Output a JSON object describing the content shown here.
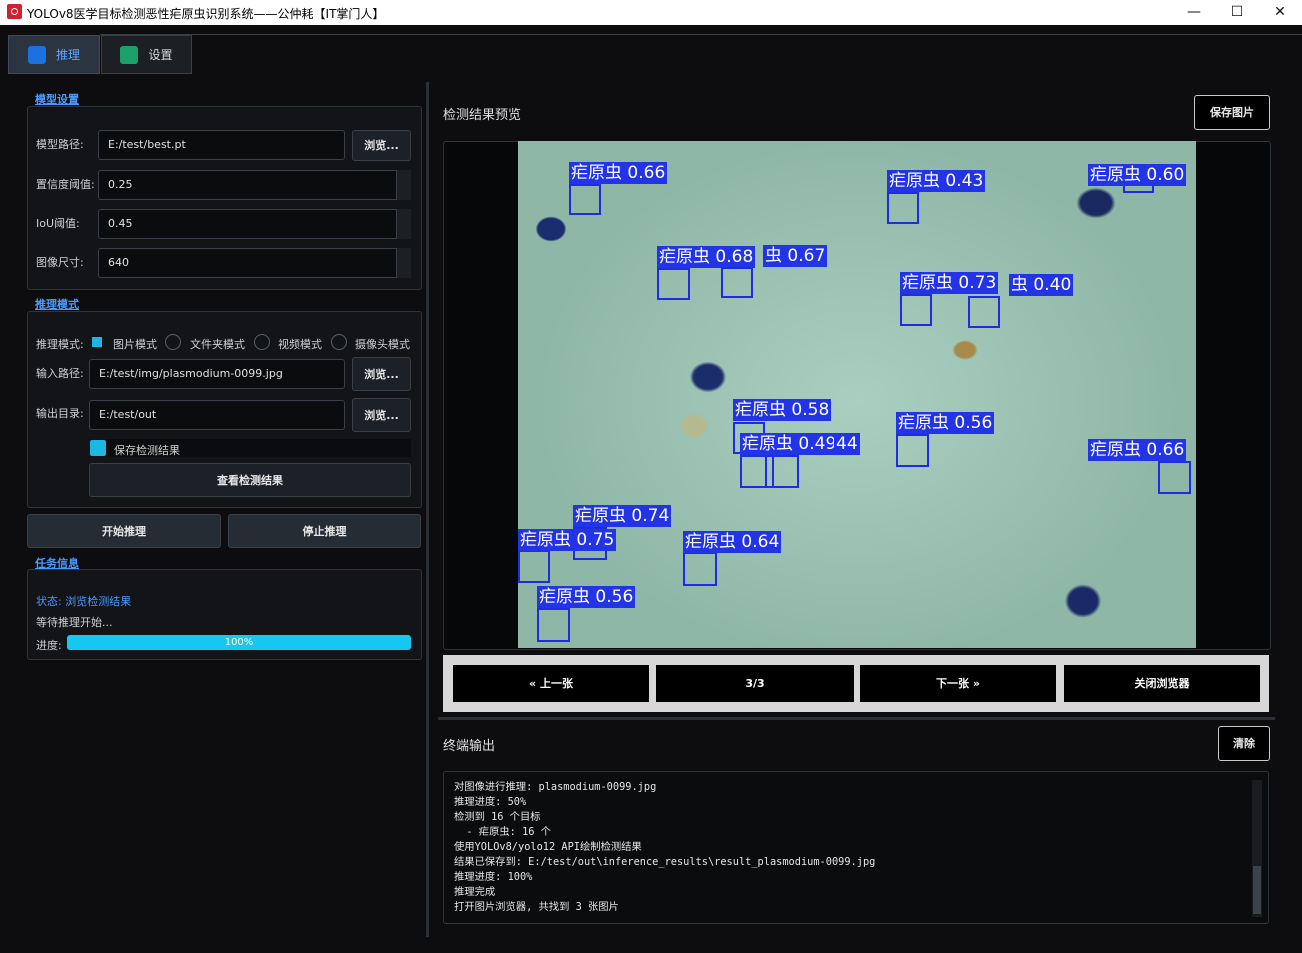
{
  "window": {
    "title": "YOLOv8医学目标检测恶性疟原虫识别系统——公仲耗【IT掌门人】",
    "minimize": "—",
    "maximize": "☐",
    "close": "✕"
  },
  "tabs": [
    {
      "label": "推理",
      "icon": "chart-icon",
      "active": true
    },
    {
      "label": "设置",
      "icon": "check-icon",
      "active": false
    }
  ],
  "model_settings": {
    "section": "模型设置",
    "model_path_label": "模型路径:",
    "model_path": "E:/test/best.pt",
    "browse": "浏览...",
    "conf_label": "置信度阈值:",
    "conf": "0.25",
    "iou_label": "IoU阈值:",
    "iou": "0.45",
    "imgsz_label": "图像尺寸:",
    "imgsz": "640"
  },
  "inference_mode": {
    "section": "推理模式",
    "mode_label": "推理模式:",
    "modes": [
      "图片模式",
      "文件夹模式",
      "视频模式",
      "摄像头模式"
    ],
    "selected_mode": "图片模式",
    "input_label": "输入路径:",
    "input": "E:/test/img/plasmodium-0099.jpg",
    "input_browse": "浏览...",
    "output_label": "输出目录:",
    "output": "E:/test/out",
    "output_browse": "浏览...",
    "save_label": "保存检测结果",
    "save_checked": true,
    "view_results": "查看检测结果"
  },
  "actions": {
    "start": "开始推理",
    "stop": "停止推理"
  },
  "task_info": {
    "section": "任务信息",
    "status": "状态: 浏览检测结果",
    "waiting": "等待推理开始...",
    "progress_label": "进度:",
    "progress_text": "100%",
    "progress_value": 1.0
  },
  "preview": {
    "title": "检测结果预览",
    "save_button": "保存图片",
    "detections": [
      {
        "label": "疟原虫 0.66"
      },
      {
        "label": "疟原虫 0.43"
      },
      {
        "label": "疟原虫 0.60"
      },
      {
        "label": "疟原虫 0.68"
      },
      {
        "label": "虫 0.67"
      },
      {
        "label": "疟原虫 0.73"
      },
      {
        "label": "虫 0.40"
      },
      {
        "label": "疟原虫 0.58"
      },
      {
        "label": "疟原虫 0.49"
      },
      {
        "label": "44"
      },
      {
        "label": "疟原虫 0.56"
      },
      {
        "label": "疟原虫 0.66"
      },
      {
        "label": "疟原虫 0.74"
      },
      {
        "label": "疟原虫 0.75"
      },
      {
        "label": "疟原虫 0.64"
      },
      {
        "label": "疟原虫 0.56"
      }
    ]
  },
  "navigation": {
    "prev": "« 上一张",
    "counter": "3/3",
    "next": "下一张 »",
    "close": "关闭浏览器"
  },
  "terminal": {
    "title": "终端输出",
    "clear": "清除",
    "lines": [
      "对图像进行推理: plasmodium-0099.jpg",
      "推理进度: 50%",
      "检测到 16 个目标",
      "  - 疟原虫: 16 个",
      "使用YOLOv8/yolo12 API绘制检测结果",
      "结果已保存到: E:/test/out\\inference_results\\result_plasmodium-0099.jpg",
      "推理进度: 100%",
      "推理完成",
      "打开图片浏览器, 共找到 3 张图片"
    ]
  },
  "colors": {
    "accent": "#4a9bff",
    "progress": "#16c8f0",
    "bbox": "#1f2ce0"
  }
}
